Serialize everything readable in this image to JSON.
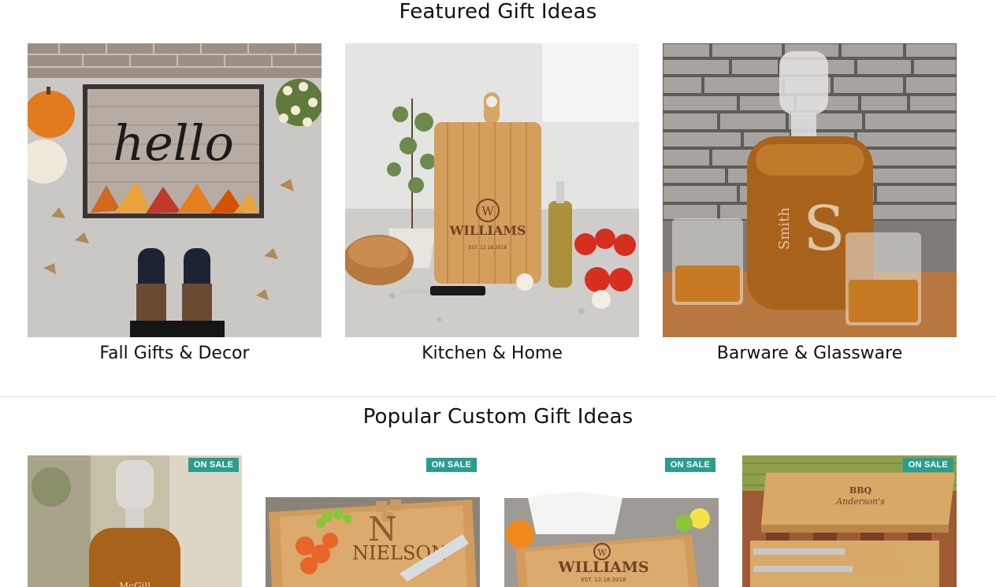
{
  "featured": {
    "title": "Featured Gift Ideas",
    "cards": [
      {
        "label": "Fall Gifts & Decor",
        "mat_text": "hello"
      },
      {
        "label": "Kitchen & Home",
        "engraving": "WILLIAMS",
        "initial": "W",
        "est": "EST. 12.18.2018"
      },
      {
        "label": "Barware & Glassware",
        "engraving": "Smith",
        "initial": "S"
      }
    ]
  },
  "popular": {
    "title": "Popular Custom Gift Ideas",
    "badge": "ON SALE",
    "products": [
      {
        "engraving": "McGill"
      },
      {
        "engraving": "NIELSON",
        "initial": "N"
      },
      {
        "engraving": "WILLIAMS",
        "initial": "W",
        "est": "EST. 12.18.2018"
      },
      {
        "engraving": "Anderson's",
        "tag": "BBQ"
      }
    ]
  },
  "colors": {
    "sale_badge": "#2a9d8f"
  }
}
